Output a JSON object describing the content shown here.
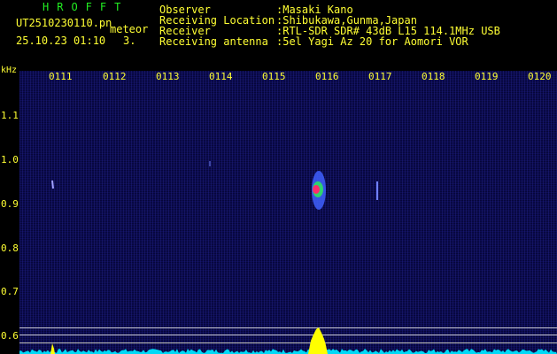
{
  "header": {
    "app_title": "HROFFT",
    "file_name": "UT2510230110.pn",
    "meteor_label": "meteor",
    "datetime": "25.10.23 01:10",
    "count": "3.",
    "info": [
      {
        "label": "Observer",
        "value": ":Masaki Kano"
      },
      {
        "label": "Receiving Location",
        "value": ":Shibukawa,Gunma,Japan"
      },
      {
        "label": "Receiver",
        "value": ":RTL-SDR SDR# 43dB L15 114.1MHz USB"
      },
      {
        "label": "Receiving antenna",
        "value": ":5el Yagi Az 20 for Aomori VOR"
      }
    ]
  },
  "spectrogram": {
    "unit": "kHz",
    "time_ticks": [
      "0111",
      "0112",
      "0113",
      "0114",
      "0115",
      "0116",
      "0117",
      "0118",
      "0119",
      "0120"
    ],
    "freq_ticks": [
      "1.1",
      "1.0",
      "0.9",
      "0.8",
      "0.7",
      "0.6"
    ],
    "colors": {
      "background": "#06063a",
      "text": "#ffff33",
      "title": "#22ee22",
      "spectrum": "#00e5ff",
      "peak": "#ffff00",
      "echo_core": "#ff2a6d",
      "echo_mid": "#30e060",
      "echo_outer": "#4060ff"
    }
  }
}
